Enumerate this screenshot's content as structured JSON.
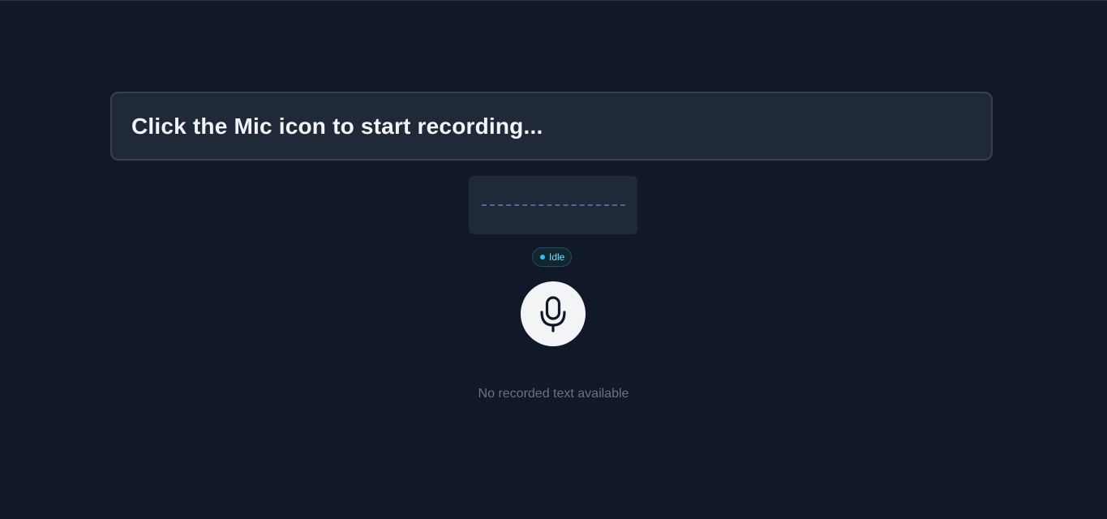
{
  "prompt": {
    "text": "Click the Mic icon to start recording..."
  },
  "status": {
    "label": "Idle",
    "dot_color": "#38bdf8"
  },
  "mic_button": {
    "icon": "microphone-icon"
  },
  "transcript": {
    "empty_message": "No recorded text available"
  },
  "colors": {
    "background": "#111827",
    "panel": "#1f2937",
    "accent": "#67e8f9"
  }
}
